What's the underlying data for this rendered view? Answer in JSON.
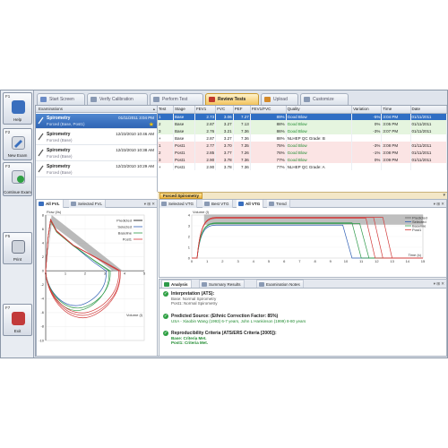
{
  "fkeys": [
    {
      "num": "F1",
      "label": "Help",
      "icon": "help-book-icon"
    },
    {
      "num": "F2",
      "label": "New Exam",
      "icon": "new-exam-icon"
    },
    {
      "num": "F3",
      "label": "Continue Exam",
      "icon": "continue-exam-icon"
    },
    {
      "num": "F5",
      "label": "Print",
      "icon": "printer-icon"
    },
    {
      "num": "F7",
      "label": "Exit",
      "icon": "exit-door-icon"
    }
  ],
  "tabs": [
    "Start Screen",
    "Verify Calibration",
    "Perform Test",
    "Review Tests",
    "Upload",
    "Customize"
  ],
  "active_tab": "Review Tests",
  "examinations": {
    "header": "Examinations",
    "items": [
      {
        "title": "Spirometry",
        "date": "01/11/2011 3:04 PM",
        "subtitle": "Forced (Base, Post1)"
      },
      {
        "title": "Spirometry",
        "date": "12/23/2010 10:46 AM",
        "subtitle": "Forced (Base)"
      },
      {
        "title": "Spirometry",
        "date": "12/23/2010 10:38 AM",
        "subtitle": "Forced (Base)"
      },
      {
        "title": "Spirometry",
        "date": "12/23/2010 10:29 AM",
        "subtitle": "Forced (Base)"
      }
    ]
  },
  "tests": {
    "columns": [
      "Test",
      "Stage",
      "FEV1",
      "FVC",
      "PEF",
      "FEV1/FVC",
      "Quality",
      "Variation",
      "Time",
      "Date"
    ],
    "rows": [
      {
        "test": "1",
        "stage": "Base",
        "fev1": "2.73",
        "fvc": "3.06",
        "pef": "7.27",
        "ratio": "89%",
        "quality": "Good Blow",
        "variation": "-5%",
        "time": "3:04 PM",
        "date": "01/11/2011",
        "style": "sel"
      },
      {
        "test": "2",
        "stage": "Base",
        "fev1": "2.87",
        "fvc": "3.27",
        "pef": "7.13",
        "ratio": "88%",
        "quality": "Good Blow",
        "variation": "0%",
        "time": "3:05 PM",
        "date": "01/11/2011",
        "style": "green"
      },
      {
        "test": "3",
        "stage": "Base",
        "fev1": "2.76",
        "fvc": "3.21",
        "pef": "7.36",
        "ratio": "86%",
        "quality": "Good Blow",
        "variation": "-3%",
        "time": "3:07 PM",
        "date": "01/11/2011",
        "style": "green"
      },
      {
        "test": "+",
        "stage": "Base",
        "fev1": "2.87",
        "fvc": "3.27",
        "pef": "7.36",
        "ratio": "88%",
        "quality": "NLHEP QC Grade: B",
        "variation": "",
        "time": "",
        "date": "",
        "style": "white"
      },
      {
        "test": "1",
        "stage": "Post1",
        "fev1": "2.77",
        "fvc": "3.70",
        "pef": "7.35",
        "ratio": "75%",
        "quality": "Good Blow",
        "variation": "-3%",
        "time": "3:08 PM",
        "date": "01/11/2011",
        "style": "pink"
      },
      {
        "test": "2",
        "stage": "Post1",
        "fev1": "2.85",
        "fvc": "3.77",
        "pef": "7.26",
        "ratio": "76%",
        "quality": "Good Blow",
        "variation": "-1%",
        "time": "3:08 PM",
        "date": "01/11/2011",
        "style": "pink"
      },
      {
        "test": "3",
        "stage": "Post1",
        "fev1": "2.90",
        "fvc": "3.78",
        "pef": "7.36",
        "ratio": "77%",
        "quality": "Good Blow",
        "variation": "0%",
        "time": "3:09 PM",
        "date": "01/11/2011",
        "style": "pink"
      },
      {
        "test": "+",
        "stage": "Post1",
        "fev1": "2.90",
        "fvc": "3.78",
        "pef": "7.36",
        "ratio": "77%",
        "quality": "NLHEP QC Grade: A",
        "variation": "",
        "time": "",
        "date": "",
        "style": "white"
      }
    ],
    "section_label": "Forced Spirometry"
  },
  "fvl": {
    "tabs": [
      "All FVL",
      "Selected FVL"
    ],
    "active_tab": "All FVL",
    "ylabel": "Flow (l/s)",
    "xlabel": "Volume (l)",
    "legend": [
      "Predicted",
      "Selected",
      "Baseline",
      "Post1"
    ],
    "yticks": [
      "8",
      "6",
      "4",
      "2",
      "0",
      "-2",
      "-4",
      "-6",
      "-8",
      "-10"
    ],
    "xticks": [
      "0",
      "1",
      "2",
      "3",
      "4",
      "5"
    ]
  },
  "vtg": {
    "tabs": [
      "Selected VTG",
      "Best VTG",
      "All VTG",
      "Trend"
    ],
    "active_tab": "All VTG",
    "ylabel": "Volume (l)",
    "xlabel": "Time (s)",
    "legend": [
      "Predicted",
      "Selected",
      "Baseline",
      "Post1"
    ],
    "yticks": [
      "4",
      "3",
      "2",
      "1",
      "0"
    ],
    "xticks": [
      "0",
      "1",
      "2",
      "3",
      "4",
      "5",
      "6",
      "7",
      "8",
      "9",
      "10",
      "11",
      "12",
      "13",
      "14",
      "15"
    ]
  },
  "analysis": {
    "tabs": [
      "Analysis",
      "Summary Results",
      "Examination Notes"
    ],
    "active_tab": "Analysis",
    "items": [
      {
        "heading": "Interpretation (ATS):",
        "lines": [
          "Base: Normal Spirometry",
          "Post1: Normal Spirometry"
        ]
      },
      {
        "heading": "Predicted Source:  (Ethnic Correction Factor: 85%)",
        "lines": [
          "USA - Xiaobin Wang (1993) 6-7 years, John L Hankinson (1999) 8-80 years"
        ]
      },
      {
        "heading": "Reproducibility Criteria (ATS/ERS Criteria [2005]):",
        "lines": [
          "Base:  Criteria Met.",
          "Post1:  Criteria Met."
        ]
      }
    ]
  },
  "colors": {
    "selected": "#2f5fb5",
    "baseline": "#2e9a4a",
    "post1": "#d23b3b",
    "predicted": "#9a9a9a",
    "accent": "#f3c35c"
  }
}
